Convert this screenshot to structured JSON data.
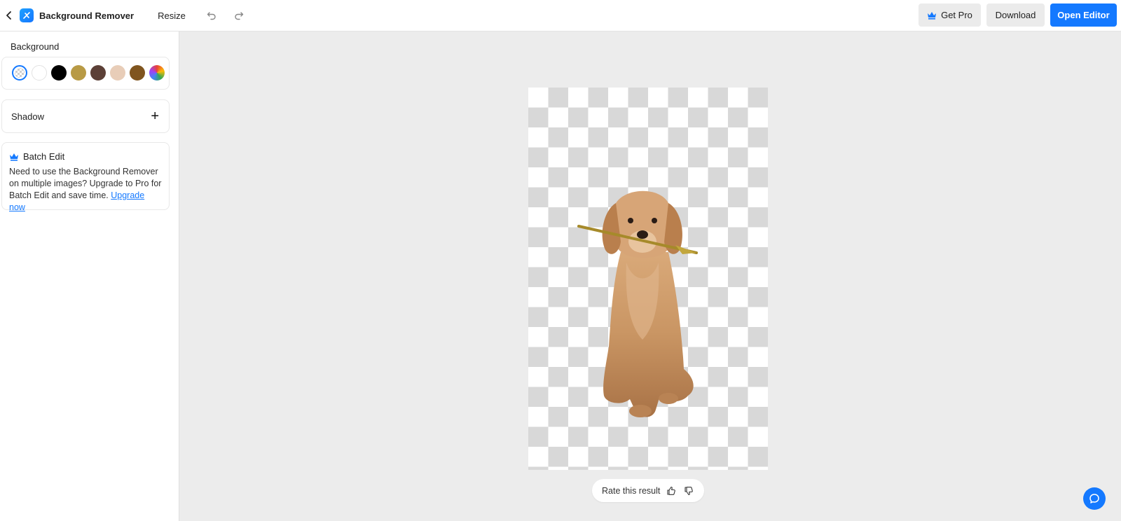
{
  "header": {
    "app_title": "Background Remover",
    "resize_label": "Resize",
    "get_pro_label": "Get Pro",
    "download_label": "Download",
    "open_editor_label": "Open Editor"
  },
  "sidebar": {
    "background_label": "Background",
    "swatches": [
      {
        "name": "transparent",
        "color": "transparent",
        "selected": true
      },
      {
        "name": "white",
        "color": "#ffffff"
      },
      {
        "name": "black",
        "color": "#000000"
      },
      {
        "name": "gold",
        "color": "#b89a45"
      },
      {
        "name": "dark-brown",
        "color": "#5c4037"
      },
      {
        "name": "beige",
        "color": "#e8cdb8"
      },
      {
        "name": "brown",
        "color": "#80551f"
      },
      {
        "name": "multicolor",
        "color": "gradient"
      }
    ],
    "shadow_label": "Shadow",
    "batch": {
      "title": "Batch Edit",
      "text": "Need to use the Background Remover on multiple images? Upgrade to Pro for Batch Edit and save time.",
      "link": "Upgrade now"
    }
  },
  "canvas": {
    "rate_label": "Rate this result"
  },
  "colors": {
    "accent": "#1479ff",
    "canvas_bg": "#ececec"
  }
}
